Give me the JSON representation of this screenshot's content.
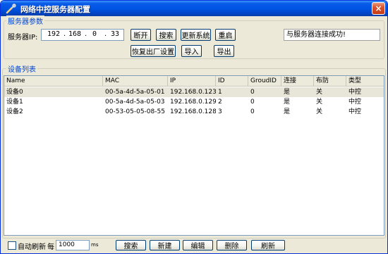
{
  "window": {
    "title": "网络中控服务器配置",
    "close_label": "×"
  },
  "server_params": {
    "legend": "服务器参数",
    "ip_label": "服务器IP:",
    "ip_octets": [
      "192",
      "168",
      "0",
      "33"
    ],
    "buttons": {
      "disconnect": "断开",
      "search": "搜索",
      "update_system": "更新系统",
      "restart": "重启",
      "factory_reset": "恢复出厂设置",
      "import": "导入",
      "export": "导出"
    },
    "status": "与服务器连接成功!"
  },
  "device_list": {
    "legend": "设备列表",
    "columns": [
      "Name",
      "MAC",
      "IP",
      "ID",
      "GroudID",
      "连接",
      "布防",
      "类型"
    ],
    "rows": [
      [
        "设备0",
        "00-5a-4d-5a-05-01",
        "192.168.0.123",
        "1",
        "0",
        "是",
        "关",
        "中控"
      ],
      [
        "设备1",
        "00-5a-4d-5a-05-03",
        "192.168.0.129",
        "2",
        "0",
        "是",
        "关",
        "中控"
      ],
      [
        "设备2",
        "00-53-05-05-08-55",
        "192.168.0.128",
        "3",
        "0",
        "是",
        "关",
        "中控"
      ]
    ],
    "selected_row": 0
  },
  "footer": {
    "auto_refresh_label": "自动刷新",
    "every_label": "每",
    "interval_value": "1000",
    "unit": "ms",
    "buttons": {
      "search": "搜索",
      "new": "新建",
      "edit": "编辑",
      "delete": "删除",
      "refresh": "刷新"
    }
  }
}
